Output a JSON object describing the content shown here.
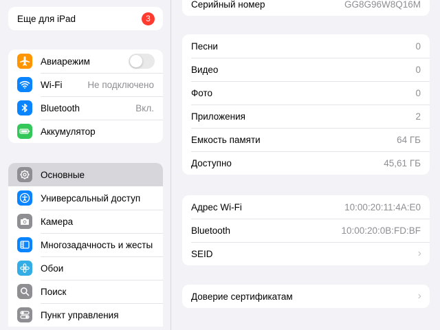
{
  "sidebar": {
    "promo": {
      "label": "Еще для iPad",
      "badge": "3"
    },
    "connectivity": [
      {
        "label": "Авиарежим",
        "icon": "airplane-icon",
        "color": "#ff9500",
        "toggle_on": false
      },
      {
        "label": "Wi-Fi",
        "value": "Не подключено",
        "icon": "wifi-icon",
        "color": "#0a84ff"
      },
      {
        "label": "Bluetooth",
        "value": "Вкл.",
        "icon": "bluetooth-icon",
        "color": "#0a84ff"
      },
      {
        "label": "Аккумулятор",
        "icon": "battery-icon",
        "color": "#34c759"
      }
    ],
    "settings": [
      {
        "label": "Основные",
        "icon": "gear-icon",
        "color": "#8e8e93",
        "selected": true
      },
      {
        "label": "Универсальный доступ",
        "icon": "accessibility-icon",
        "color": "#0a84ff"
      },
      {
        "label": "Камера",
        "icon": "camera-icon",
        "color": "#8e8e93"
      },
      {
        "label": "Многозадачность и жесты",
        "icon": "multitasking-icon",
        "color": "#0a84ff"
      },
      {
        "label": "Обои",
        "icon": "wallpaper-icon",
        "color": "#32ade6"
      },
      {
        "label": "Поиск",
        "icon": "search-icon",
        "color": "#8e8e93"
      },
      {
        "label": "Пункт управления",
        "icon": "control-center-icon",
        "color": "#8e8e93"
      }
    ]
  },
  "detail": {
    "serial": {
      "label": "Серийный номер",
      "value": "GG8G96W8Q16M"
    },
    "counts": [
      {
        "label": "Песни",
        "value": "0"
      },
      {
        "label": "Видео",
        "value": "0"
      },
      {
        "label": "Фото",
        "value": "0"
      },
      {
        "label": "Приложения",
        "value": "2"
      },
      {
        "label": "Емкость памяти",
        "value": "64 ГБ"
      },
      {
        "label": "Доступно",
        "value": "45,61 ГБ"
      }
    ],
    "network": [
      {
        "label": "Адрес Wi-Fi",
        "value": "10:00:20:11:4A:E0"
      },
      {
        "label": "Bluetooth",
        "value": "10:00:20:0B:FD:BF"
      },
      {
        "label": "SEID",
        "chevron": true
      }
    ],
    "trust": {
      "label": "Доверие сертификатам"
    }
  },
  "colors": {
    "background": "#f2f2f7",
    "selected": "#d6d6db",
    "badge": "#ff3b30",
    "secondary_text": "#8e8e93"
  }
}
